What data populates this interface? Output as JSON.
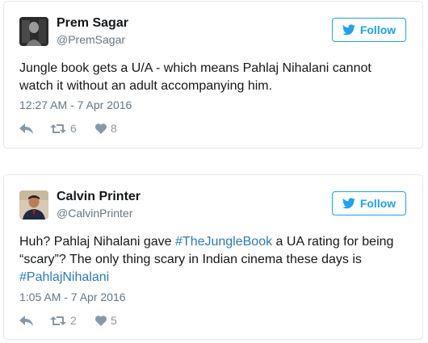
{
  "colors": {
    "accent": "#1da1f2",
    "hashtag": "#2b7bb9",
    "text": "#14171a",
    "secondary_text": "#657786",
    "action_icon": "#8899a6",
    "card_border": "#e1e8ed"
  },
  "tweets": [
    {
      "display_name": "Prem Sagar",
      "handle": "@PremSagar",
      "follow_label": "Follow",
      "follow_icon": "twitter-bird-icon",
      "text": "Jungle book gets a U/A - which means Pahlaj Nihalani cannot watch it without an adult accompanying him.",
      "timestamp": "12:27 AM - 7 Apr 2016",
      "retweets": "6",
      "likes": "8"
    },
    {
      "display_name": "Calvin Printer",
      "handle": "@CalvinPrinter",
      "follow_label": "Follow",
      "follow_icon": "twitter-bird-icon",
      "text_parts": {
        "t1": "Huh? Pahlaj Nihalani gave ",
        "hashtag1": "#TheJungleBook",
        "t2": " a UA rating for being “scary”? The only thing scary in Indian cinema these days is ",
        "hashtag2": "#PahlajNihalani"
      },
      "timestamp": "1:05 AM - 7 Apr 2016",
      "retweets": "2",
      "likes": "5"
    }
  ]
}
